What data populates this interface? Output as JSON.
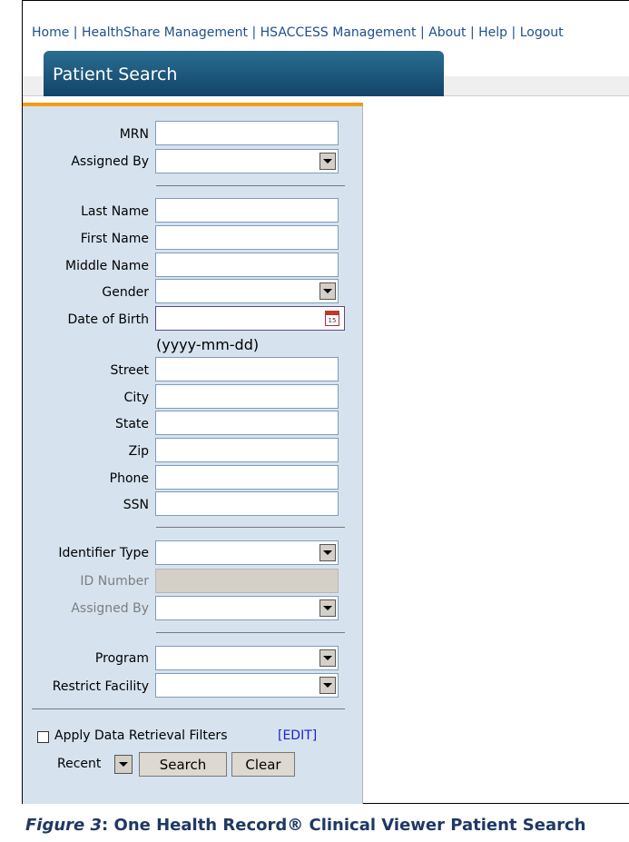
{
  "nav": {
    "links": [
      "Home",
      "HealthShare Management",
      "HSACCESS Management",
      "About",
      "Help",
      "Logout"
    ],
    "separator": " | "
  },
  "tab": {
    "title": "Patient Search"
  },
  "form": {
    "mrn_label": "MRN",
    "assigned_by_label": "Assigned By",
    "last_name_label": "Last Name",
    "first_name_label": "First Name",
    "middle_name_label": "Middle Name",
    "gender_label": "Gender",
    "dob_label": "Date of Birth",
    "dob_hint": "(yyyy-mm-dd)",
    "street_label": "Street",
    "city_label": "City",
    "state_label": "State",
    "zip_label": "Zip",
    "phone_label": "Phone",
    "ssn_label": "SSN",
    "identifier_type_label": "Identifier Type",
    "id_number_label": "ID Number",
    "id_assigned_by_label": "Assigned By",
    "program_label": "Program",
    "restrict_facility_label": "Restrict Facility",
    "filters_label": "Apply Data Retrieval Filters",
    "edit_link": "[EDIT]",
    "recent_label": "Recent",
    "search_button": "Search",
    "clear_button": "Clear"
  },
  "caption": {
    "prefix": "Figure 3",
    "text": ": One Health Record® Clinical Viewer Patient Search"
  },
  "colors": {
    "tab_bg": "#1f5a80",
    "panel_bg": "#d6e3ef",
    "accent_bar": "#f39c12",
    "link": "#1f4f8f"
  }
}
